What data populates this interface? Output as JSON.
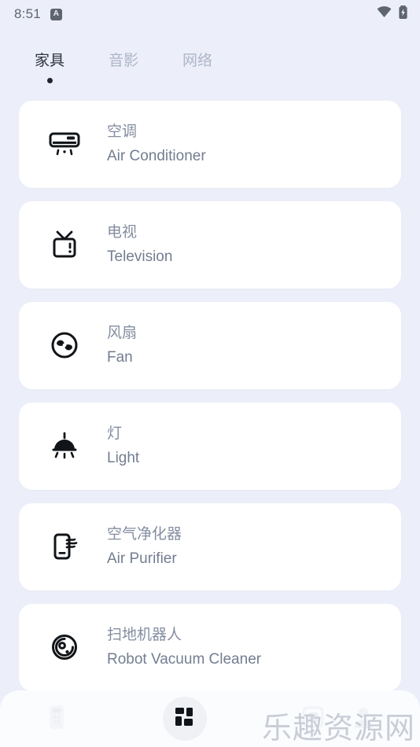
{
  "status_bar": {
    "time": "8:51",
    "app_badge_letter": "A",
    "icons": [
      "wifi-icon",
      "battery-charging-icon"
    ]
  },
  "tabs": [
    {
      "label": "家具",
      "active": true
    },
    {
      "label": "音影",
      "active": false
    },
    {
      "label": "网络",
      "active": false
    }
  ],
  "devices": [
    {
      "icon": "air-conditioner-icon",
      "name_cn": "空调",
      "name_en": "Air Conditioner"
    },
    {
      "icon": "television-icon",
      "name_cn": "电视",
      "name_en": "Television"
    },
    {
      "icon": "fan-icon",
      "name_cn": "风扇",
      "name_en": "Fan"
    },
    {
      "icon": "ceiling-light-icon",
      "name_cn": "灯",
      "name_en": "Light"
    },
    {
      "icon": "air-purifier-icon",
      "name_cn": "空气净化器",
      "name_en": "Air Purifier"
    },
    {
      "icon": "robot-vacuum-icon",
      "name_cn": "扫地机器人",
      "name_en": "Robot Vacuum Cleaner"
    }
  ],
  "bottom_nav": [
    {
      "icon": "remote-control-icon",
      "active": false
    },
    {
      "icon": "grid-dashboard-icon",
      "active": true
    },
    {
      "icon": "scan-device-icon",
      "active": false
    },
    {
      "icon": "profile-icon",
      "active": false
    }
  ],
  "watermark": {
    "text": "乐趣资源网"
  },
  "colors": {
    "page_background": "#eceff9",
    "card_background": "#ffffff",
    "tab_active": "#2d3340",
    "tab_inactive": "#aeb6c8",
    "title_cn": "#848da0",
    "title_en": "#737d91",
    "icon": "#111418",
    "fab_background": "#f0f1f4",
    "watermark": "#c9cdd6"
  }
}
